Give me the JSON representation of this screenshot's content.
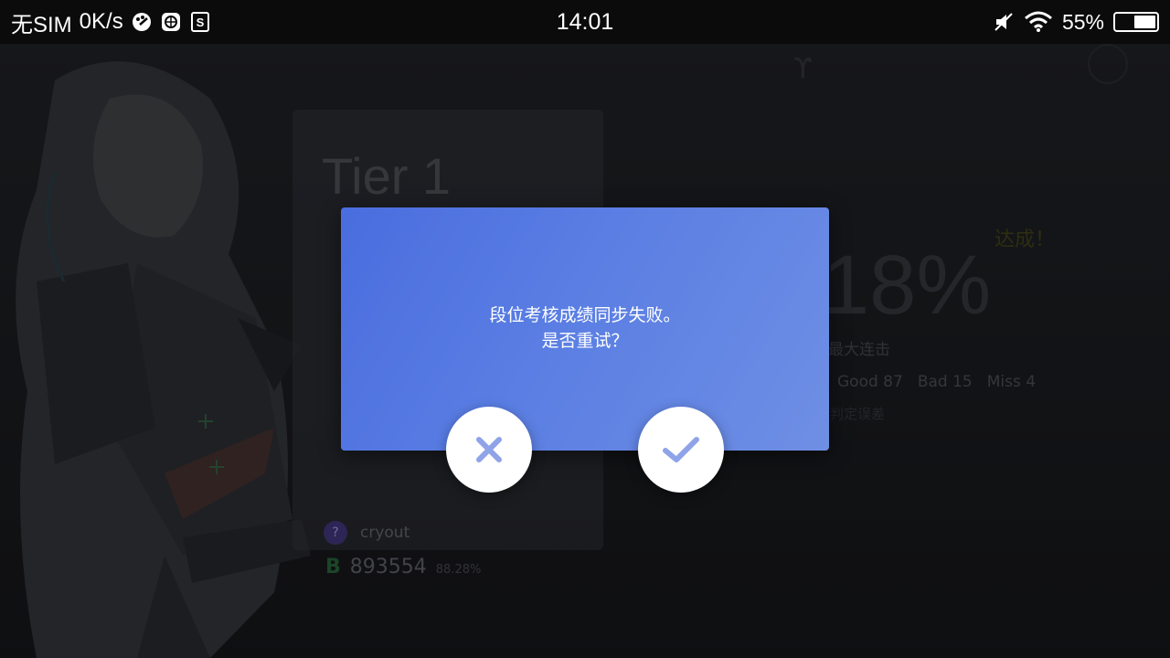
{
  "status_bar": {
    "carrier": "无SIM",
    "speed": "0K/s",
    "time": "14:01",
    "battery": "55%",
    "battery_level": 0.55,
    "icons": [
      "palette-icon",
      "globe-icon",
      "storage-icon",
      "mute-icon",
      "wifi-icon",
      "battery-icon"
    ]
  },
  "background": {
    "tier_title": "Tier 1",
    "player_badge": "?",
    "player_name": "cryout",
    "grade": "B",
    "score": "893554",
    "score_pct": "88.28%",
    "big_percent": "18%",
    "achieved": "达成！",
    "max_combo_label": "最大连击",
    "judgements": [
      "Good 87",
      "Bad 15",
      "Miss 4"
    ],
    "judge_detail": "判定误差"
  },
  "dialog": {
    "line1": "段位考核成绩同步失败。",
    "line2": "是否重试？",
    "accent": "#4a6ddf"
  },
  "buttons": {
    "cancel_icon": "close-icon",
    "confirm_icon": "check-icon",
    "icon_color": "#8fa3e8"
  }
}
